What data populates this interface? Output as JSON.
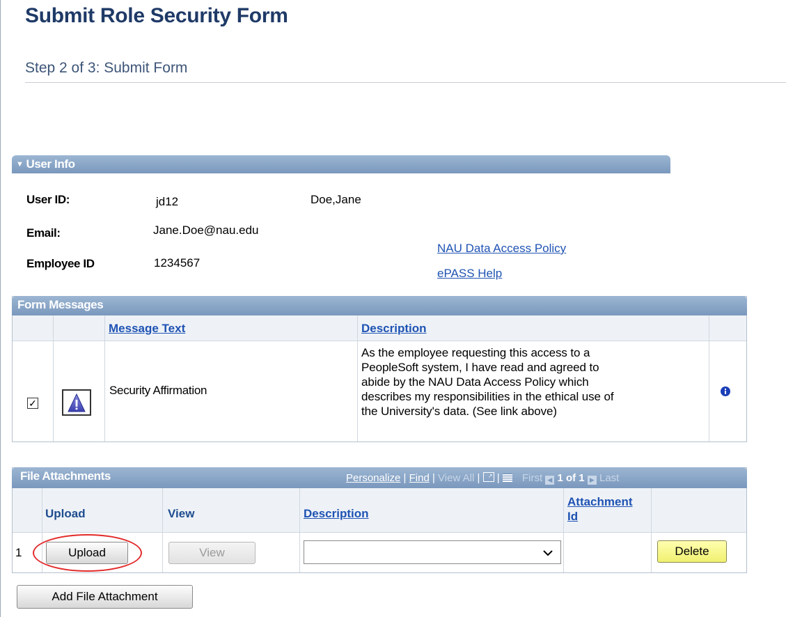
{
  "page": {
    "title": "Submit Role Security Form",
    "step": "Step 2 of 3: Submit Form"
  },
  "user_info": {
    "header": "User Info",
    "labels": {
      "user_id": "User ID:",
      "email": "Email:",
      "employee_id": "Employee ID"
    },
    "values": {
      "user_id": "jd12",
      "name": "Doe,Jane",
      "email": "Jane.Doe@nau.edu",
      "employee_id": "1234567"
    },
    "links": {
      "policy": "NAU Data Access Policy",
      "help": "ePASS Help"
    }
  },
  "form_messages": {
    "header": "Form Messages",
    "columns": {
      "message_text": "Message Text",
      "description": "Description"
    },
    "rows": [
      {
        "checked": true,
        "message_text": "Security Affirmation",
        "description_lines": [
          "As the employee requesting this access to a",
          "PeopleSoft system, I have read and agreed to",
          "abide by the NAU Data Access Policy which",
          "describes my responsibilities in the ethical use of",
          "the University's data. (See link above)"
        ]
      }
    ]
  },
  "file_attachments": {
    "header": "File Attachments",
    "toolbar": {
      "personalize": "Personalize",
      "find": "Find",
      "view_all": "View All",
      "first": "First",
      "count": "1 of 1",
      "last": "Last"
    },
    "columns": {
      "upload": "Upload",
      "view": "View",
      "description": "Description",
      "attachment_id_1": "Attachment",
      "attachment_id_2": "Id"
    },
    "rows": [
      {
        "row_num": "1",
        "upload_label": "Upload",
        "view_label": "View",
        "description": "",
        "attachment_id": "",
        "delete_label": "Delete"
      }
    ],
    "add_label": "Add File Attachment"
  },
  "colors": {
    "header_blue": "#7a98bd",
    "title": "#1f3a67",
    "link": "#1f53b3",
    "highlight_circle": "#e32a2a",
    "delete_button": "#f0f070"
  }
}
